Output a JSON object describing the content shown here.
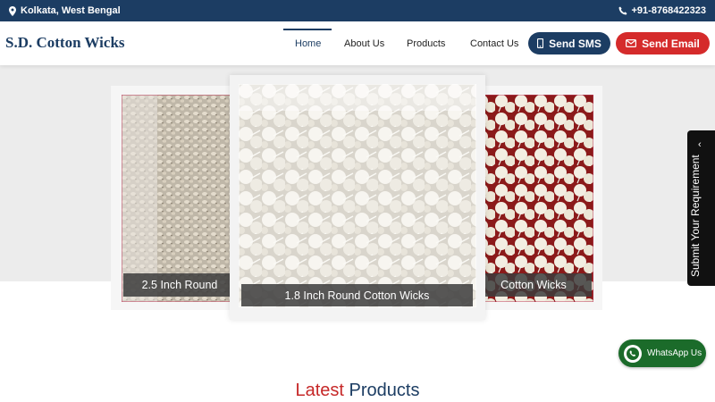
{
  "topbar": {
    "location": "Kolkata, West Bengal",
    "phone": "+91-8768422323"
  },
  "header": {
    "brand": "S.D. Cotton Wicks",
    "nav": [
      "Home",
      "About Us",
      "Products",
      "Contact Us"
    ],
    "active_nav": "Home",
    "sms_label": "Send SMS",
    "email_label": "Send Email"
  },
  "slider": {
    "cards": [
      {
        "caption": "2.5 Inch Round"
      },
      {
        "caption": "1.8 Inch Round Cotton Wicks"
      },
      {
        "caption": "Cotton Wicks"
      }
    ]
  },
  "side_tab": {
    "label": "Submit Your Requirement"
  },
  "whatsapp": {
    "label": "WhatsApp Us"
  },
  "section": {
    "title_part1": "Latest",
    "title_part2": "Products"
  },
  "colors": {
    "navy": "#1c3d63",
    "red": "#d52b2b",
    "whatsapp_green": "#1b6b2a"
  }
}
